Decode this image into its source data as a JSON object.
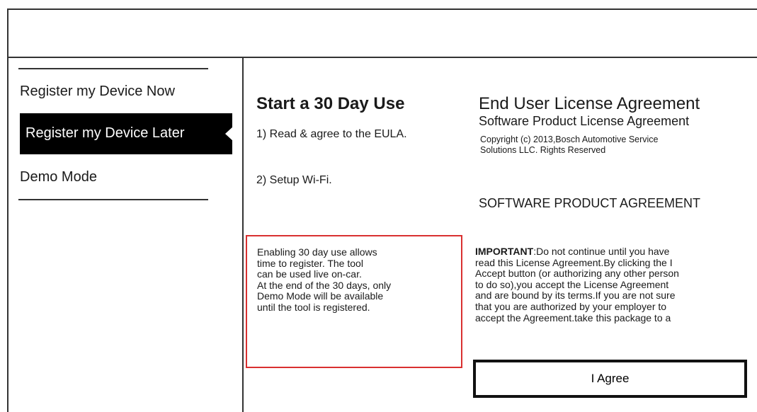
{
  "sidebar": {
    "items": [
      {
        "label": "Register my Device Now",
        "selected": false
      },
      {
        "label": "Register my Device Later",
        "selected": true
      },
      {
        "label": "Demo Mode",
        "selected": false
      }
    ]
  },
  "main": {
    "title_part1": "Start a 30 Day ",
    "title_part2": "Use",
    "steps": [
      "1) Read & agree to the EULA.",
      "2) Setup Wi-Fi."
    ],
    "info_lines": [
      "Enabling 30 day use allows",
      "time to register.  The tool",
      "can be used live on-car.",
      "At the end of the 30 days, only",
      "Demo Mode will be available",
      "until the tool is registered."
    ]
  },
  "eula": {
    "title": "End User License Agreement",
    "subtitle": "Software Product License Agreement",
    "copyright_lines": [
      "Copyright (c) 2013,Bosch Automotive Service",
      "Solutions LLC. Rights Reserved"
    ],
    "heading": "SOFTWARE PRODUCT AGREEMENT",
    "body_lead": "IMPORTANT",
    "body_first_rest": ":Do not continue until you have",
    "body_lines": [
      "read this License Agreement.By clicking the I",
      "Accept button (or authorizing any other person",
      "to do so),you accept the License Agreement",
      "and are bound by its terms.If you are not sure",
      "that you are authorized by your employer to",
      "accept the Agreement.take this package to a"
    ],
    "agree_label": "I Agree"
  },
  "colors": {
    "selected_bg": "#000000",
    "info_border": "#d93030"
  }
}
